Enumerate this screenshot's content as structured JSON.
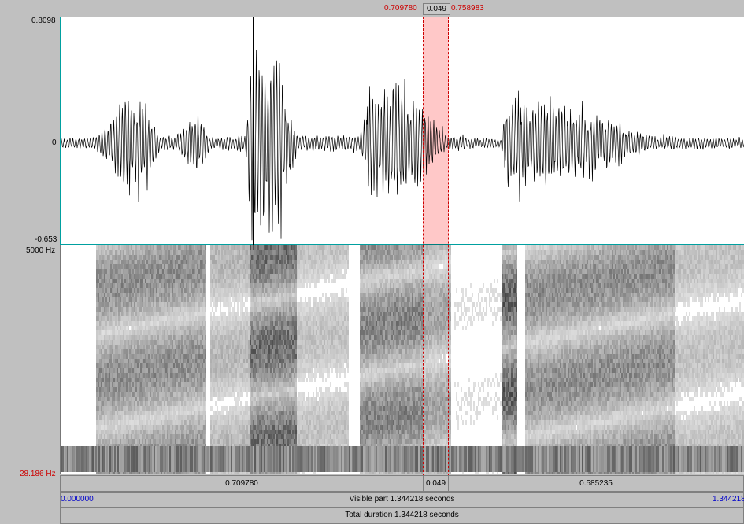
{
  "waveform": {
    "y_max": "0.8098",
    "y_zero": "0",
    "y_min": "-0.653"
  },
  "spectrogram": {
    "freq_max": "5000 Hz",
    "freq_min": "28.186 Hz"
  },
  "selection": {
    "start": "0.709780",
    "duration": "0.049",
    "end": "0.758983"
  },
  "time_bar": {
    "left_segment": "0.709780",
    "mid_segment": "0.049",
    "right_segment": "0.585235"
  },
  "visible_bar": {
    "start": "0.000000",
    "label": "Visible part 1.344218 seconds",
    "end": "1.344218"
  },
  "total_bar": {
    "label": "Total duration 1.344218 seconds"
  },
  "colors": {
    "selection": "#ffc8c8",
    "selection_line": "#cc0000",
    "wave_border": "#00a0a0",
    "time_blue": "#0000cc"
  }
}
